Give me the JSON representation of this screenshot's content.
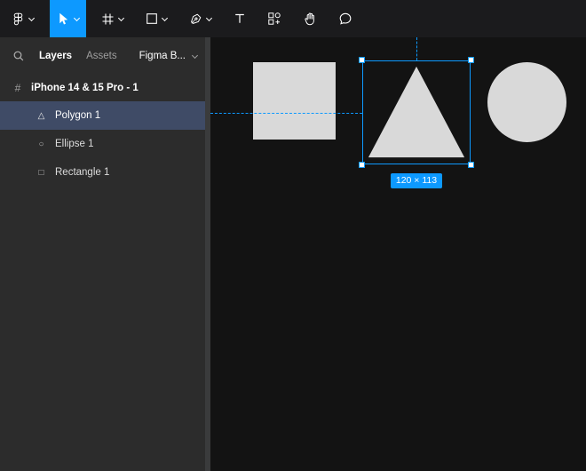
{
  "colors": {
    "accent": "#0d99ff",
    "toolbar-bg": "#1b1b1d",
    "sidebar-bg": "#2c2c2c",
    "canvas-bg": "#131313",
    "selected-row-bg": "#3f4b66",
    "shape-fill": "#d9d9d9",
    "text-primary": "#ffffff",
    "text-secondary": "#9e9e9e",
    "divider": "#3a3b3c"
  },
  "toolbar": {
    "tools": [
      {
        "name": "main-menu",
        "icon": "figma-logo-icon",
        "dropdown": true,
        "active": false
      },
      {
        "name": "move-tool",
        "icon": "cursor-arrow-icon",
        "dropdown": true,
        "active": true
      },
      {
        "name": "frame-tool",
        "icon": "frame-hash-icon",
        "dropdown": true,
        "active": false
      },
      {
        "name": "shape-tool",
        "icon": "rectangle-outline-icon",
        "dropdown": true,
        "active": false
      },
      {
        "name": "pen-tool",
        "icon": "pen-nib-icon",
        "dropdown": true,
        "active": false
      },
      {
        "name": "text-tool",
        "icon": "letter-t-icon",
        "dropdown": false,
        "active": false
      },
      {
        "name": "actions-tool",
        "icon": "shapes-plus-icon",
        "dropdown": false,
        "active": false
      },
      {
        "name": "hand-tool",
        "icon": "hand-icon",
        "dropdown": false,
        "active": false
      },
      {
        "name": "comment-tool",
        "icon": "speech-bubble-icon",
        "dropdown": false,
        "active": false
      }
    ]
  },
  "sidebar": {
    "search_icon": "search-icon",
    "tabs": [
      {
        "label": "Layers",
        "active": true
      },
      {
        "label": "Assets",
        "active": false
      }
    ],
    "library_dropdown": {
      "label": "Figma B...",
      "icon": "chevron-down-icon"
    },
    "frame": {
      "label": "iPhone 14 & 15 Pro - 1",
      "icon": "frame",
      "icon_glyph": "#"
    },
    "layers": [
      {
        "label": "Polygon 1",
        "icon": "polygon",
        "icon_glyph": "△",
        "selected": true
      },
      {
        "label": "Ellipse 1",
        "icon": "ellipse",
        "icon_glyph": "○",
        "selected": false
      },
      {
        "label": "Rectangle 1",
        "icon": "rectangle",
        "icon_glyph": "□",
        "selected": false
      }
    ]
  },
  "canvas": {
    "selection": {
      "size_label": "120 × 113"
    },
    "shapes": [
      {
        "name": "Rectangle 1",
        "type": "rectangle",
        "fill": "#d9d9d9",
        "selected": false
      },
      {
        "name": "Polygon 1",
        "type": "polygon",
        "fill": "#d9d9d9",
        "selected": true
      },
      {
        "name": "Ellipse 1",
        "type": "ellipse",
        "fill": "#d9d9d9",
        "selected": false
      }
    ]
  }
}
